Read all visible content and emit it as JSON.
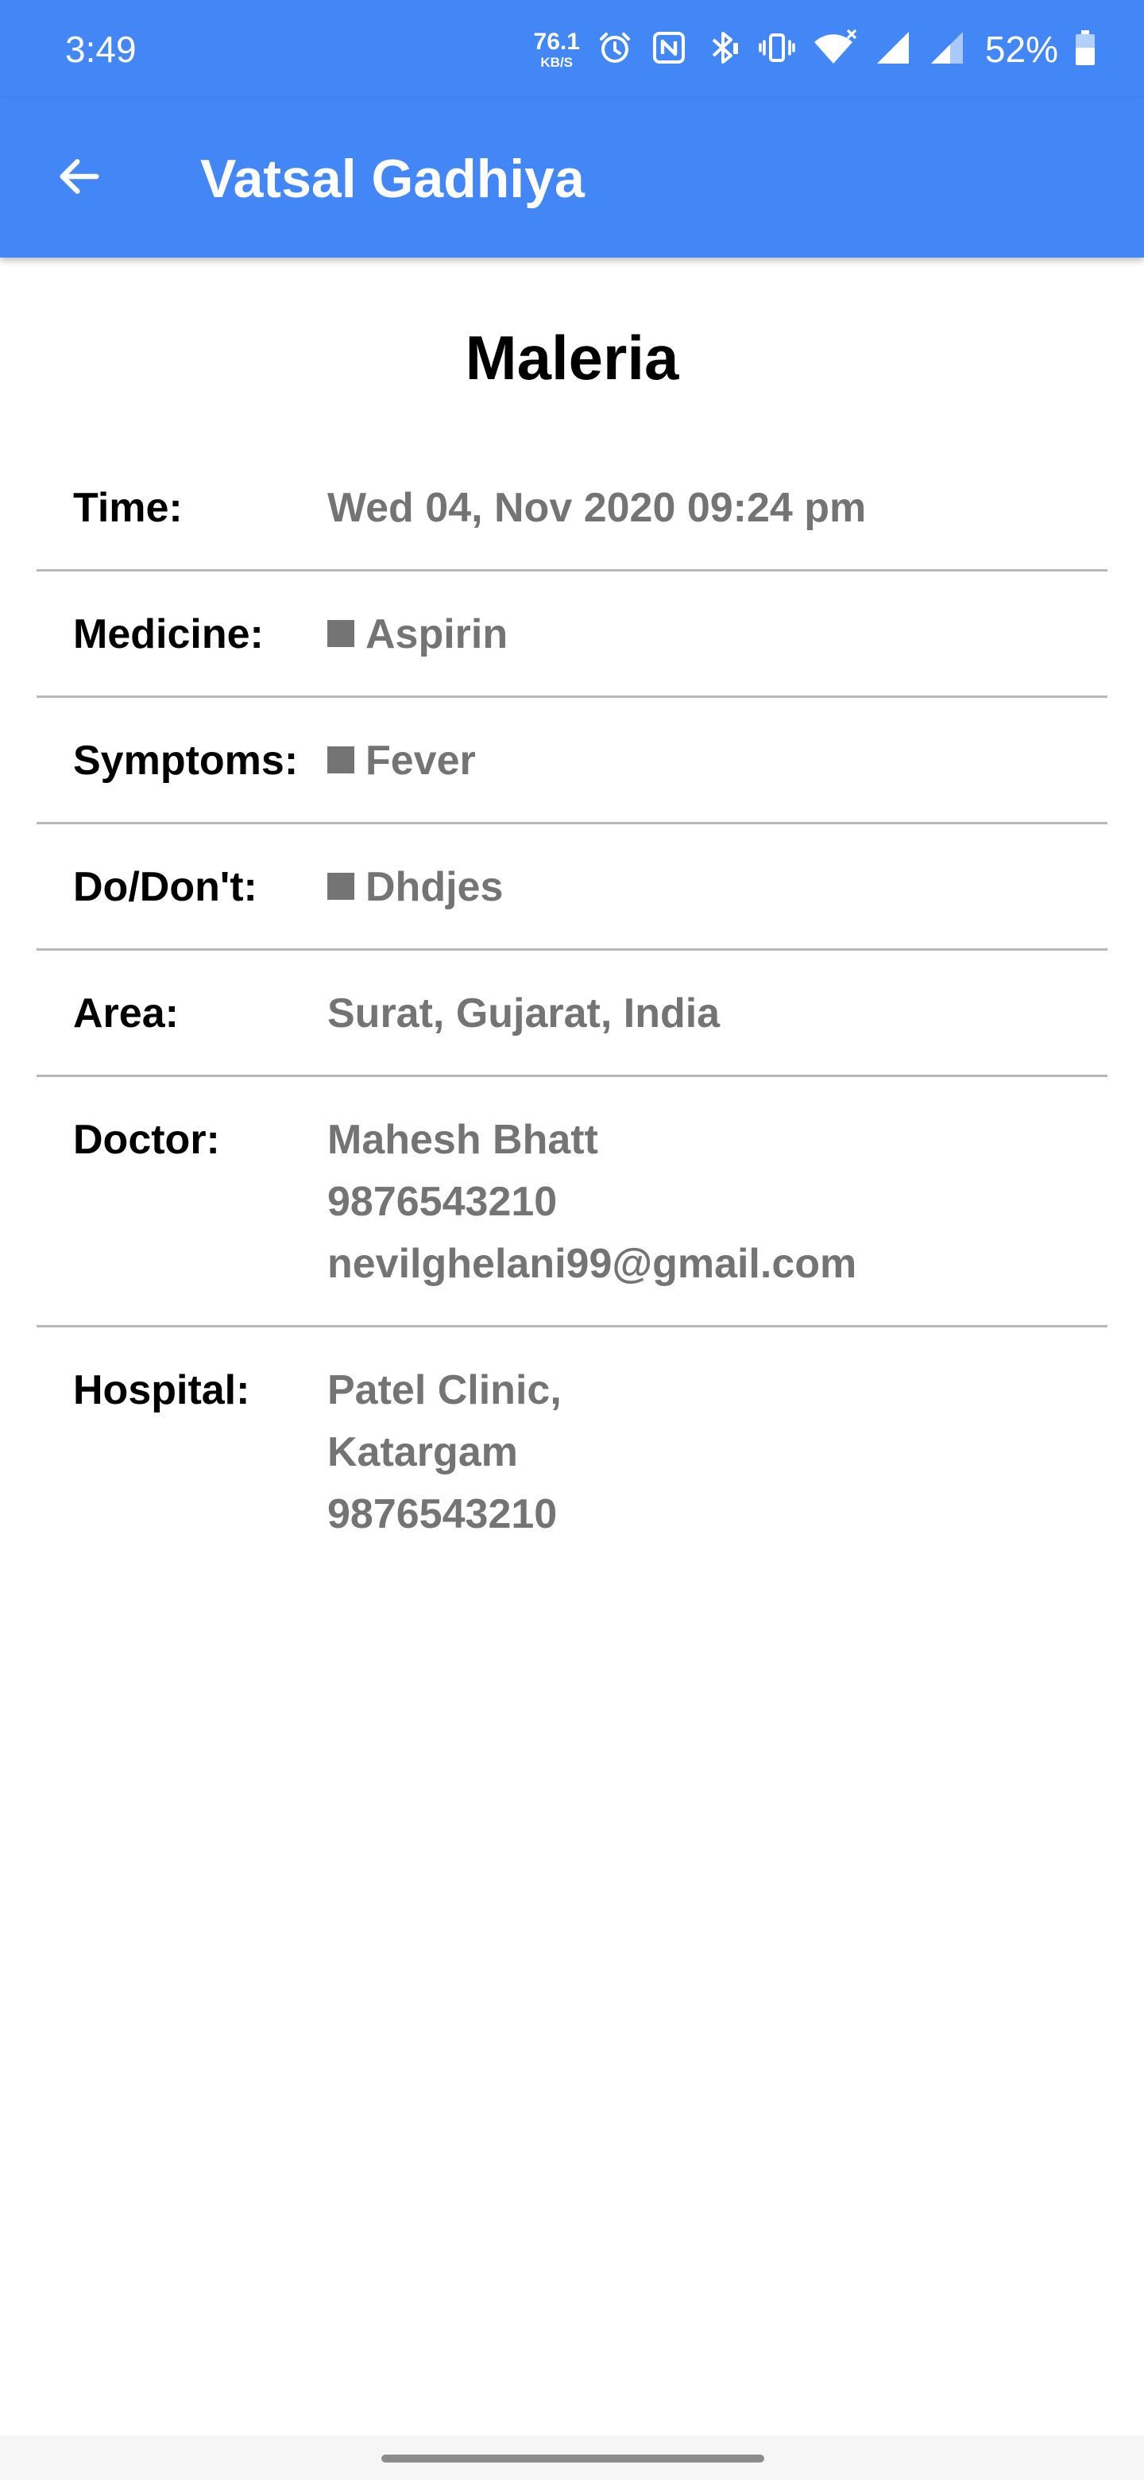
{
  "status_bar": {
    "time": "3:49",
    "net_speed_value": "76.1",
    "net_speed_unit": "KB/S",
    "battery_percent": "52%",
    "icons": [
      "alarm-icon",
      "nfc-icon",
      "bluetooth-icon",
      "vibrate-icon",
      "wifi-icon",
      "signal-icon",
      "signal-icon-2",
      "battery-icon"
    ]
  },
  "app_bar": {
    "title": "Vatsal Gadhiya",
    "back_icon": "arrow-left-icon",
    "background": "#4287f5"
  },
  "page": {
    "title": "Maleria"
  },
  "details": {
    "time": {
      "label": "Time:",
      "value": "Wed 04, Nov 2020 09:24 pm"
    },
    "medicine": {
      "label": "Medicine:",
      "value": "Aspirin"
    },
    "symptoms": {
      "label": "Symptoms:",
      "value": "Fever"
    },
    "dos_donts": {
      "label": "Do/Don't:",
      "value": "Dhdjes"
    },
    "area": {
      "label": "Area:",
      "value": "Surat, Gujarat, India"
    },
    "doctor": {
      "label": "Doctor:",
      "name": "Mahesh Bhatt",
      "phone": "9876543210",
      "email": "nevilghelani99@gmail.com"
    },
    "hospital": {
      "label": "Hospital:",
      "name": "Patel Clinic,",
      "locality": "Katargam",
      "phone": "9876543210"
    }
  }
}
